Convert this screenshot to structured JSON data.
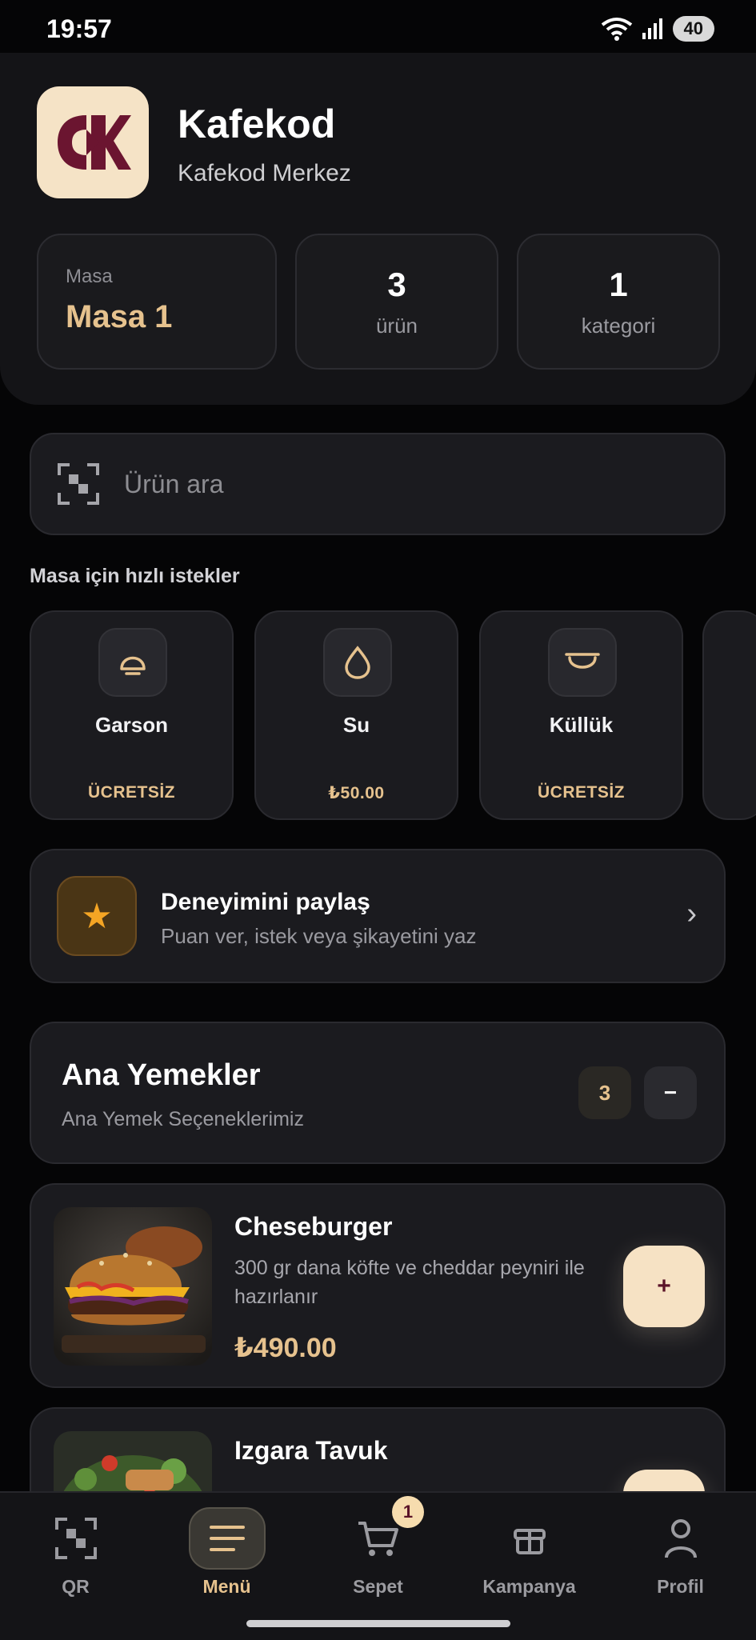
{
  "status_bar": {
    "time": "19:57",
    "battery": "40"
  },
  "header": {
    "brand_name": "Kafekod",
    "branch_name": "Kafekod Merkez",
    "table_label": "Masa",
    "table_value": "Masa 1",
    "product_count": "3",
    "product_count_label": "ürün",
    "category_count": "1",
    "category_count_label": "kategori"
  },
  "search": {
    "placeholder": "Ürün ara"
  },
  "quick_requests": {
    "title": "Masa için hızlı istekler",
    "items": [
      {
        "name": "Garson",
        "price": "ÜCRETSİZ",
        "icon": "bell-icon"
      },
      {
        "name": "Su",
        "price": "₺50.00",
        "icon": "water-drop-icon"
      },
      {
        "name": "Küllük",
        "price": "ÜCRETSİZ",
        "icon": "ashtray-icon"
      }
    ]
  },
  "feedback": {
    "title": "Deneyimini paylaş",
    "subtitle": "Puan ver, istek veya şikayetini yaz",
    "icon": "star-icon"
  },
  "category": {
    "title": "Ana Yemekler",
    "subtitle": "Ana Yemek Seçeneklerimiz",
    "count": "3",
    "toggle": "−"
  },
  "products": [
    {
      "name": "Cheseburger",
      "description": "300 gr dana köfte ve cheddar peyniri ile hazırlanır",
      "price": "₺490.00",
      "add_label": "+"
    },
    {
      "name": "Izgara Tavuk",
      "add_label": "+"
    }
  ],
  "bottom_nav": {
    "items": [
      {
        "label": "QR",
        "icon": "qr-scan-icon"
      },
      {
        "label": "Menü",
        "icon": "menu-icon",
        "active": true
      },
      {
        "label": "Sepet",
        "icon": "cart-icon",
        "badge": "1"
      },
      {
        "label": "Kampanya",
        "icon": "gift-icon"
      },
      {
        "label": "Profil",
        "icon": "user-icon"
      }
    ]
  },
  "colors": {
    "background": "#050506",
    "surface": "#1b1b1f",
    "accent": "#e6c28e",
    "brand": "#5a1328",
    "cream": "#f6e2c4"
  }
}
